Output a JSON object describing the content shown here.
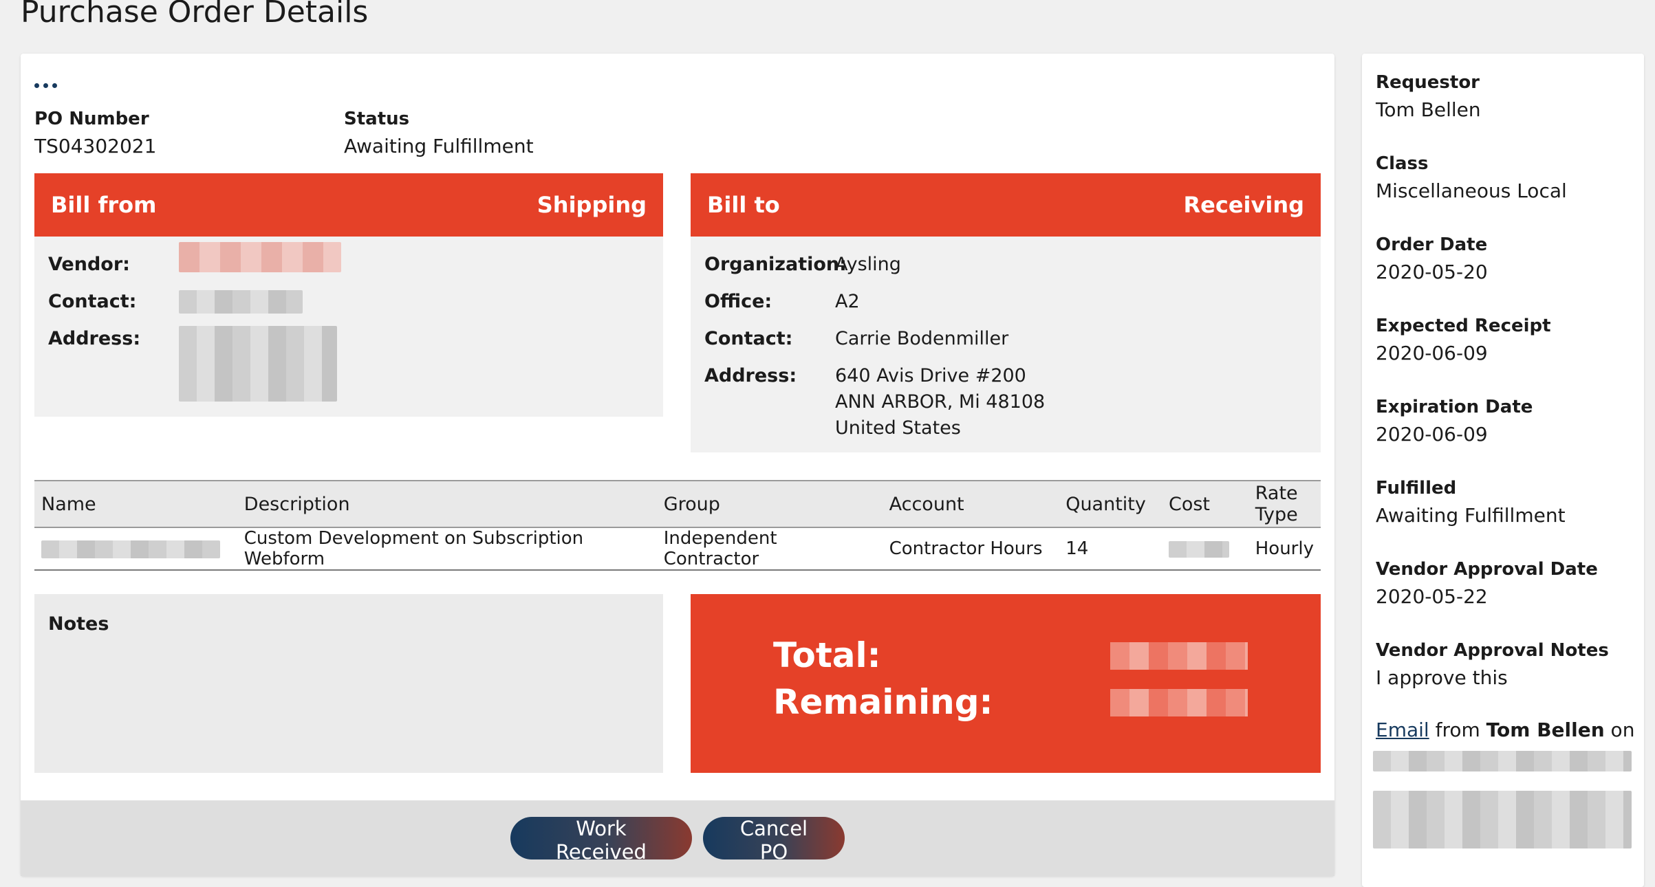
{
  "page_title": "Purchase Order Details",
  "po": {
    "number_label": "PO Number",
    "number": "TS04302021",
    "status_label": "Status",
    "status": "Awaiting Fulfillment"
  },
  "bill_from": {
    "title": "Bill from",
    "tag": "Shipping",
    "vendor_label": "Vendor:",
    "contact_label": "Contact:",
    "address_label": "Address:"
  },
  "bill_to": {
    "title": "Bill to",
    "tag": "Receiving",
    "organization_label": "Organization:",
    "organization": "Aysling",
    "office_label": "Office:",
    "office": "A2",
    "contact_label": "Contact:",
    "contact": "Carrie Bodenmiller",
    "address_label": "Address:",
    "address_line1": "640 Avis Drive #200",
    "address_line2": "ANN ARBOR, Mi 48108",
    "address_line3": "United States"
  },
  "items_table": {
    "columns": [
      "Name",
      "Description",
      "Group",
      "Account",
      "Quantity",
      "Cost",
      "Rate Type"
    ],
    "rows": [
      {
        "description": "Custom Development on Subscription Webform",
        "group": "Independent Contractor",
        "account": "Contractor Hours",
        "quantity": "14",
        "rate_type": "Hourly"
      }
    ]
  },
  "notes": {
    "label": "Notes"
  },
  "totals": {
    "total_label": "Total:",
    "remaining_label": "Remaining:"
  },
  "actions": {
    "work_received": "Work Received",
    "cancel_po": "Cancel PO"
  },
  "sidebar": {
    "items": [
      {
        "label": "Requestor",
        "value": "Tom Bellen"
      },
      {
        "label": "Class",
        "value": "Miscellaneous Local"
      },
      {
        "label": "Order Date",
        "value": "2020-05-20"
      },
      {
        "label": "Expected Receipt",
        "value": "2020-06-09"
      },
      {
        "label": "Expiration Date",
        "value": "2020-06-09"
      },
      {
        "label": "Fulfilled",
        "value": "Awaiting Fulfillment"
      },
      {
        "label": "Vendor Approval Date",
        "value": "2020-05-22"
      },
      {
        "label": "Vendor Approval Notes",
        "value": "I approve this"
      }
    ],
    "email_link": "Email",
    "email_from": " from ",
    "email_sender": "Tom Bellen",
    "email_on": " on"
  },
  "colors": {
    "accent": "#e54128",
    "button_start": "#173a5e",
    "button_end": "#8a3a30"
  },
  "icons": {
    "more": "more-horizontal-icon"
  }
}
